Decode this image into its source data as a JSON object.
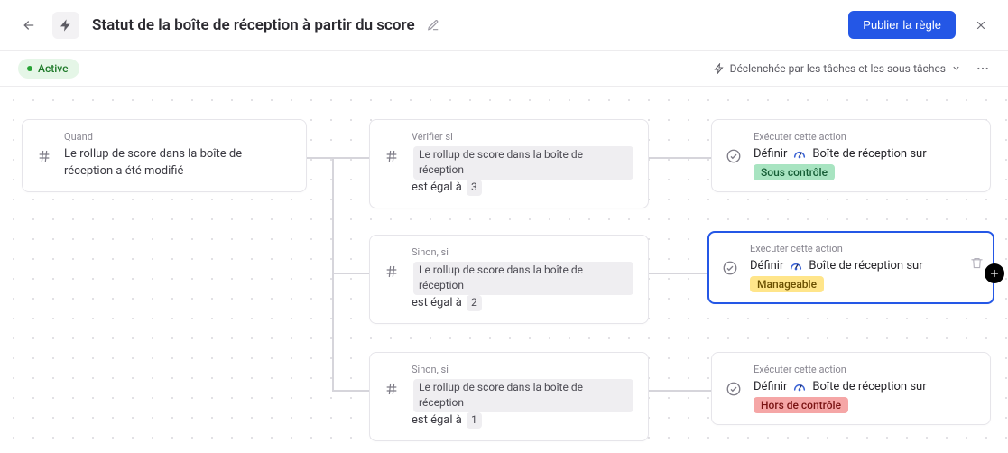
{
  "header": {
    "title": "Statut de la boîte de réception à partir du score",
    "publish_label": "Publier la règle"
  },
  "subheader": {
    "active_label": "Active",
    "trigger_label": "Déclenchée par les tâches et les sous-tâches"
  },
  "cards": {
    "trigger": {
      "label": "Quand",
      "text": "Le rollup de score dans la boîte de réception a été modifié"
    },
    "cond1": {
      "label": "Vérifier si",
      "chip": "Le rollup de score dans la boîte de réception",
      "op": "est égal à",
      "val": "3"
    },
    "cond2": {
      "label": "Sinon, si",
      "chip": "Le rollup de score dans la boîte de réception",
      "op": "est égal à",
      "val": "2"
    },
    "cond3": {
      "label": "Sinon, si",
      "chip": "Le rollup de score dans la boîte de réception",
      "op": "est égal à",
      "val": "1"
    },
    "action_label": "Exécuter cette action",
    "action_verb": "Définir",
    "action_prop": "Boîte de réception sur",
    "status1": "Sous contrôle",
    "status2": "Manageable",
    "status3": "Hors de contrôle"
  }
}
